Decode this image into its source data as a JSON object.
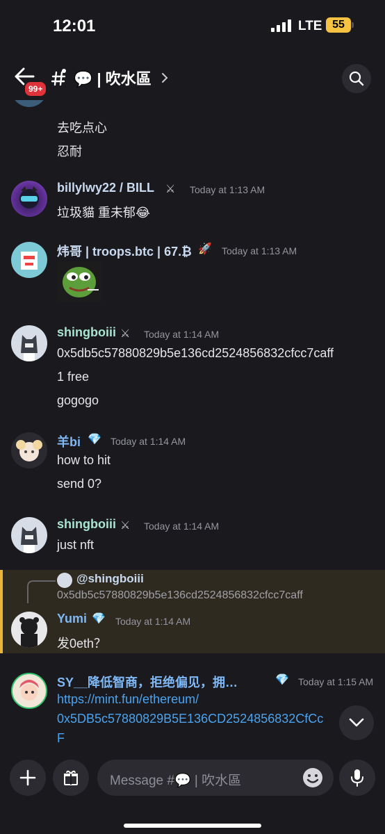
{
  "status": {
    "time": "12:01",
    "network": "LTE",
    "battery": "55"
  },
  "header": {
    "unread_badge": "99+",
    "channel_title": "💬 | 吹水區"
  },
  "partial_message": {
    "lines": [
      "去吃点心",
      "忍耐"
    ]
  },
  "messages": [
    {
      "username": "billylwy22 / BILL",
      "role": "⚔",
      "time": "Today at 1:13 AM",
      "lines": [
        "垃圾貓 重未郁😂"
      ],
      "name_color": "#c9d9ef"
    },
    {
      "username": "炜哥 | troops.btc | 67.₿",
      "role": "🚀",
      "time": "Today at 1:13 AM",
      "lines": [],
      "sticker": "pepe-frog",
      "name_color": "#c9d9ef"
    },
    {
      "username": "shingboiii",
      "role": "⚔",
      "time": "Today at 1:14 AM",
      "lines": [
        "0x5db5c57880829b5e136cd2524856832cfcc7caff",
        "1 free",
        "gogogo"
      ],
      "name_color": "#a8e4cf"
    },
    {
      "username": "羊bi",
      "role": "💎",
      "time": "Today at 1:14 AM",
      "lines": [
        "how to hit",
        "send 0?"
      ],
      "name_color": "#7fb8f5"
    },
    {
      "username": "shingboiii",
      "role": "⚔",
      "time": "Today at 1:14 AM",
      "lines": [
        "just nft"
      ],
      "name_color": "#a8e4cf"
    },
    {
      "username": "Yumi",
      "role": "💎",
      "time": "Today at 1:14 AM",
      "lines": [
        "发0eth？"
      ],
      "name_color": "#7fb8f5",
      "reply": {
        "mention": "@shingboiii",
        "text": "0x5db5c57880829b5e136cd2524856832cfcc7caff"
      }
    },
    {
      "username": "SY__降低智商，拒绝偏见，拥…",
      "role": "💎",
      "time": "Today at 1:15 AM",
      "lines": [
        "https://mint.fun/ethereum/",
        "0x5DB5c57880829B5E136CD2524856832CfCc",
        "F"
      ],
      "name_color": "#7fb8f5"
    }
  ],
  "composer": {
    "placeholder": "Message #💬 | 吹水區"
  },
  "colors": {
    "background": "#1a1a1e",
    "accent_reply": "#e8b43a",
    "link": "#4aa3f0",
    "badge": "#e0323a"
  }
}
